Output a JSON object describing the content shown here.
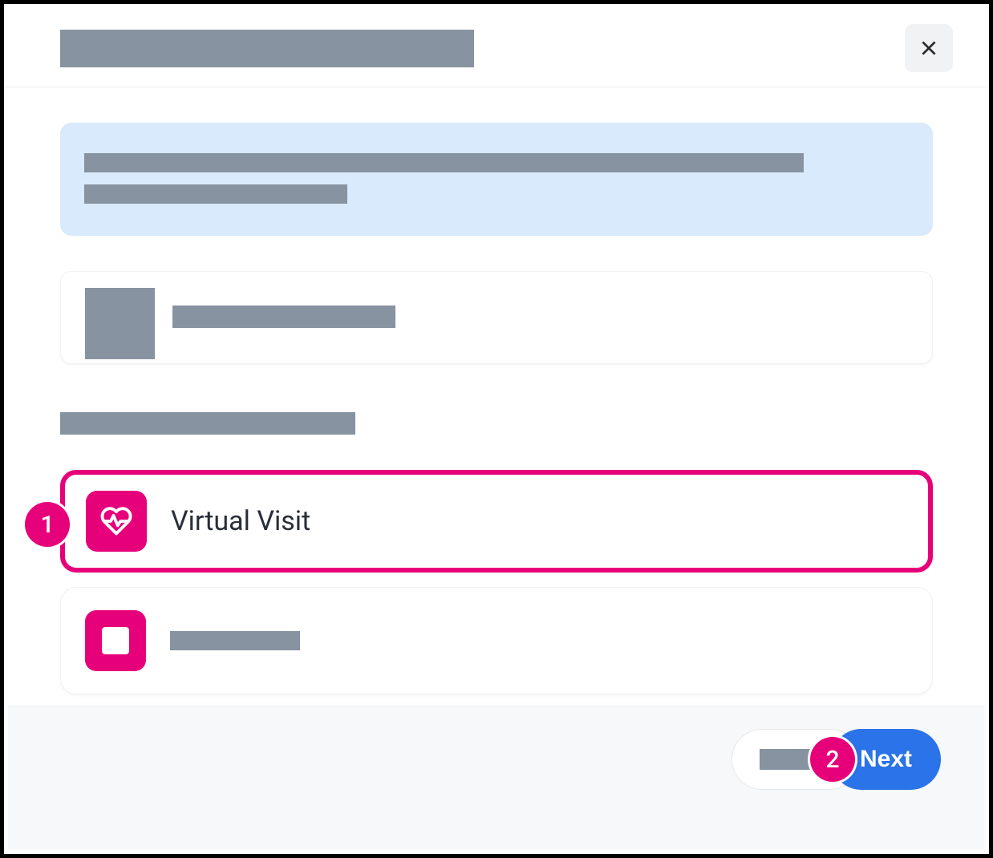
{
  "header": {
    "title_redacted": true,
    "close_aria": "Close"
  },
  "banner": {
    "line1_redacted": true,
    "line2_redacted": true
  },
  "provider": {
    "name_redacted": true
  },
  "section_heading_redacted": true,
  "options": [
    {
      "id": "virtual-visit",
      "label": "Virtual Visit",
      "icon": "heart-pulse",
      "selected": true
    },
    {
      "id": "option-2",
      "label_redacted": true,
      "icon": "square",
      "selected": false
    }
  ],
  "footer": {
    "back_label_redacted": true,
    "next_label": "Next"
  },
  "annotations": {
    "step1": "1",
    "step2": "2"
  }
}
